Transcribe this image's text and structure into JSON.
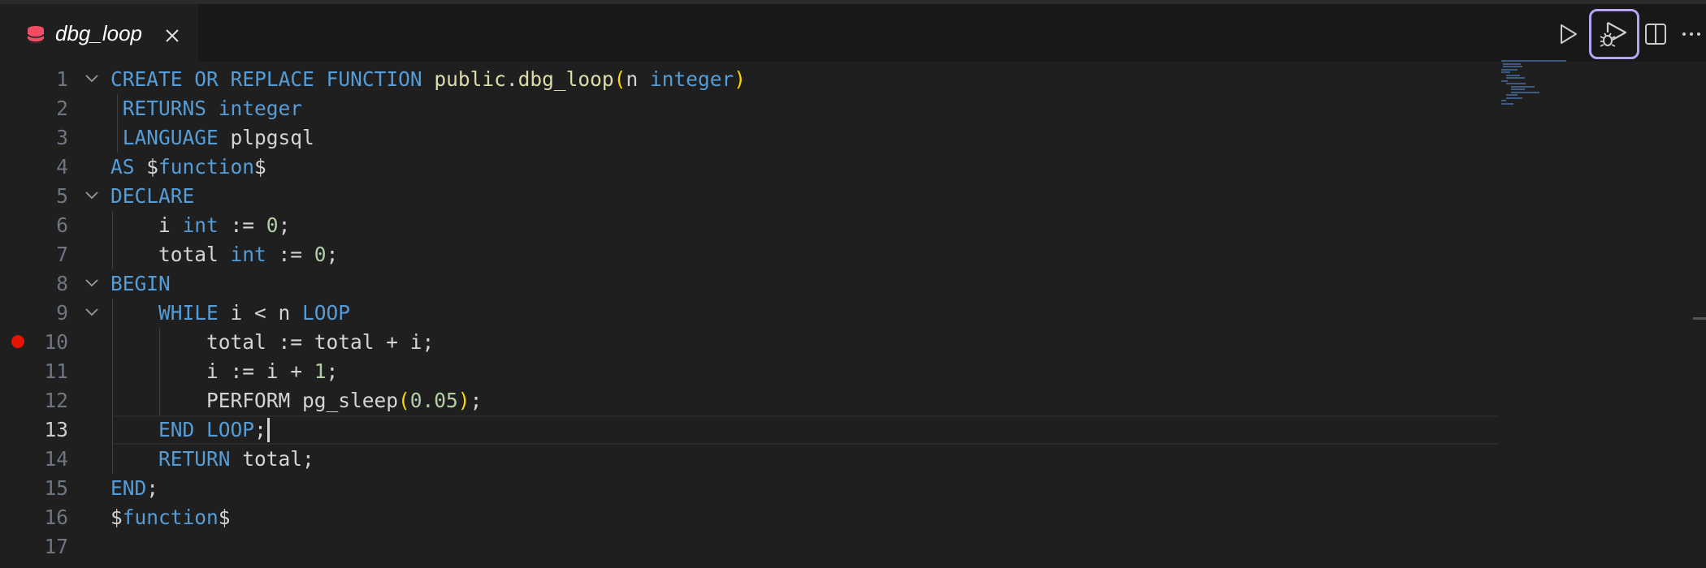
{
  "tab": {
    "label": "dbg_loop",
    "icon": "database-icon",
    "icon_color": "#f14c63"
  },
  "toolbar": {
    "buttons": [
      {
        "name": "run-button",
        "icon": "play-icon"
      },
      {
        "name": "debug-button",
        "icon": "debug-play-icon",
        "active": true
      },
      {
        "name": "split-editor-button",
        "icon": "split-editor-icon"
      },
      {
        "name": "more-actions-button",
        "icon": "ellipsis-icon"
      }
    ]
  },
  "editor": {
    "current_line": 13,
    "breakpoint_line": 10,
    "lines": [
      {
        "num": "1",
        "text": "CREATE OR REPLACE FUNCTION public.dbg_loop(n integer)"
      },
      {
        "num": "2",
        "text": " RETURNS integer"
      },
      {
        "num": "3",
        "text": " LANGUAGE plpgsql"
      },
      {
        "num": "4",
        "text": "AS $function$"
      },
      {
        "num": "5",
        "text": "DECLARE"
      },
      {
        "num": "6",
        "text": "    i int := 0;"
      },
      {
        "num": "7",
        "text": "    total int := 0;"
      },
      {
        "num": "8",
        "text": "BEGIN"
      },
      {
        "num": "9",
        "text": "    WHILE i < n LOOP"
      },
      {
        "num": "10",
        "text": "        total := total + i;"
      },
      {
        "num": "11",
        "text": "        i := i + 1;"
      },
      {
        "num": "12",
        "text": "        PERFORM pg_sleep(0.05);"
      },
      {
        "num": "13",
        "text": "    END LOOP;"
      },
      {
        "num": "14",
        "text": "    RETURN total;"
      },
      {
        "num": "15",
        "text": "END;"
      },
      {
        "num": "16",
        "text": "$function$"
      },
      {
        "num": "17",
        "text": ""
      }
    ]
  },
  "colors": {
    "keyword": "#569cd6",
    "function": "#dcdcaa",
    "number": "#b5cea8",
    "bracket": "#ffd700",
    "breakpoint": "#e51400",
    "active_button_border": "#b6a4f3"
  }
}
